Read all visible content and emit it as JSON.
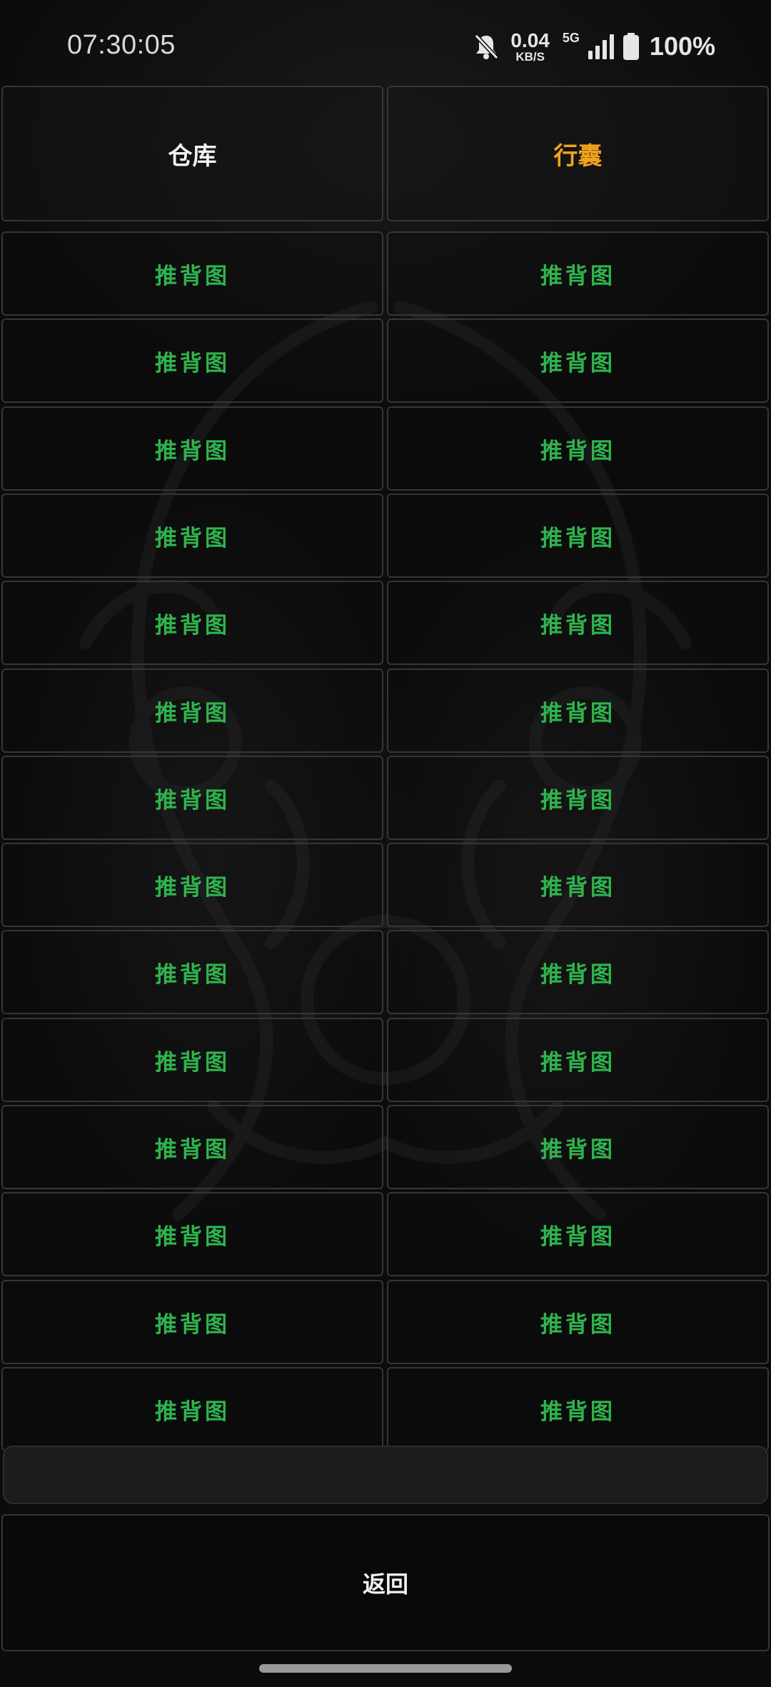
{
  "status_bar": {
    "time": "07:30:05",
    "speed_value": "0.04",
    "speed_unit": "KB/S",
    "network": "5G",
    "battery": "100%",
    "icons": [
      "bell-muted-icon",
      "signal-icon",
      "battery-icon"
    ]
  },
  "tabs": [
    {
      "label": "仓库",
      "color": "#f2f2f2"
    },
    {
      "label": "行囊",
      "color": "#f0a21f",
      "active": true
    }
  ],
  "left_column": [
    "推背图",
    "推背图",
    "推背图",
    "推背图",
    "推背图",
    "推背图",
    "推背图",
    "推背图",
    "推背图",
    "推背图",
    "推背图",
    "推背图",
    "推背图",
    "推背图"
  ],
  "right_column": [
    "推背图",
    "推背图",
    "推背图",
    "推背图",
    "推背图",
    "推背图",
    "推背图",
    "推背图",
    "推背图",
    "推背图",
    "推背图",
    "推背图",
    "推背图",
    "推背图"
  ],
  "item_color": "#2fb44e",
  "input": {
    "value": ""
  },
  "back_button": {
    "label": "返回"
  }
}
